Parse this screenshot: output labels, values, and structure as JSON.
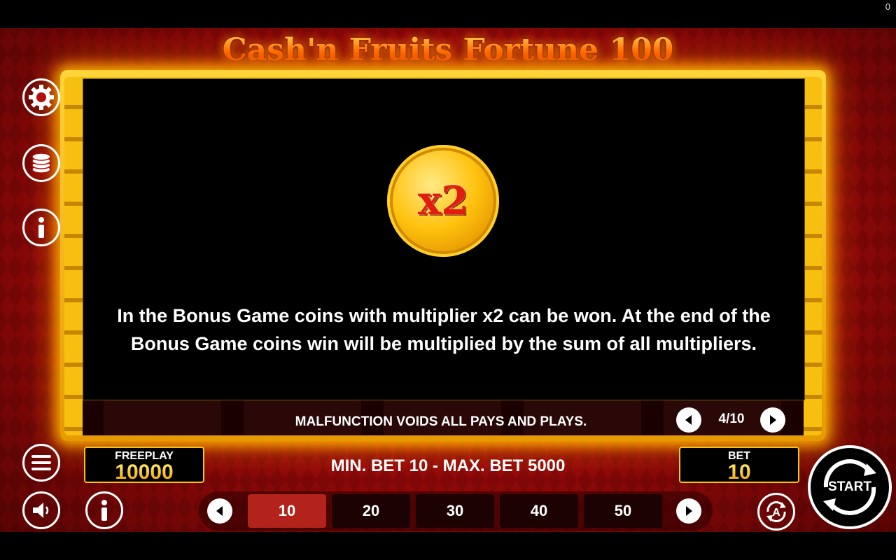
{
  "game": {
    "title": "Cash'n Fruits Fortune 100",
    "corner_counter": "0"
  },
  "info_panel": {
    "coin_label": "x2",
    "description": "In the Bonus Game coins with multiplier x2 can be won. At the end of the Bonus Game coins win will be multiplied by the sum of all multipliers.",
    "malfunction_notice": "MALFUNCTION VOIDS ALL PAYS AND PLAYS.",
    "page_indicator": "4/10"
  },
  "balance": {
    "label": "FREEPLAY",
    "value": "10000"
  },
  "bet": {
    "label": "BET",
    "value": "10",
    "range_text": "MIN. BET 10 - MAX. BET 5000",
    "options": [
      "10",
      "20",
      "30",
      "40",
      "50"
    ],
    "selected": "10"
  },
  "controls": {
    "start_label": "START",
    "auto_label": "A"
  },
  "icons": {
    "settings": "gear-icon",
    "coins": "coin-stack-icon",
    "info_side": "info-icon",
    "menu": "menu-icon",
    "sound": "speaker-icon",
    "info_bottom": "info-icon",
    "prev": "chevron-left-icon",
    "next": "chevron-right-icon"
  },
  "colors": {
    "background_red": "#b30d0d",
    "frame_gold": "#f7bf10",
    "active_bet": "#b3231b",
    "title_orange": "#ff6a00"
  }
}
